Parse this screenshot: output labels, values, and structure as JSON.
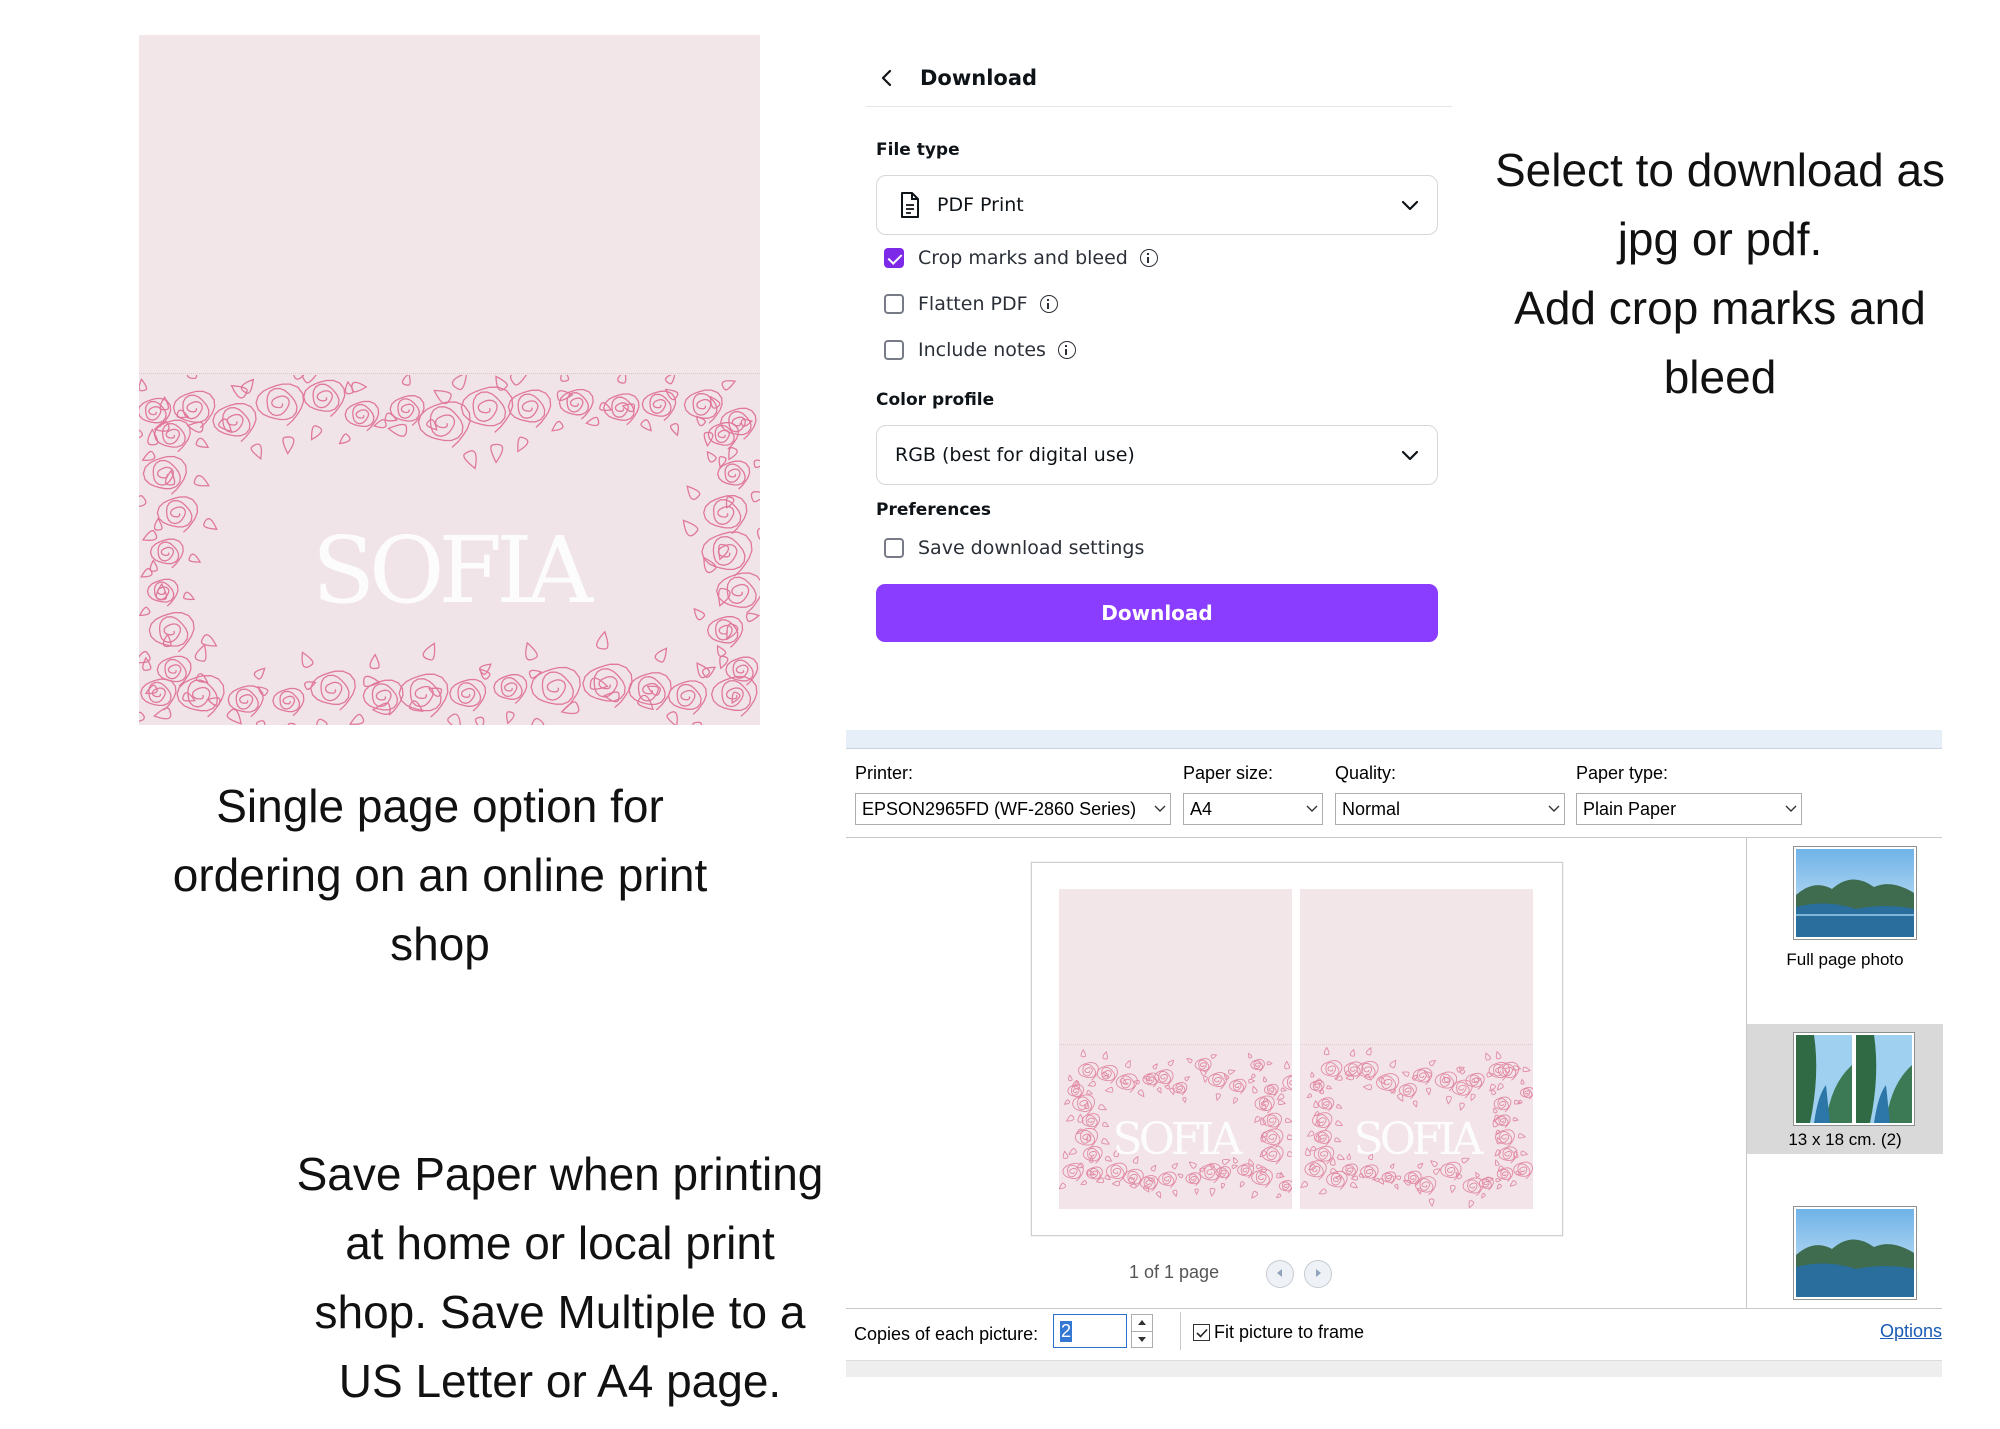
{
  "card": {
    "name": "SOFIA",
    "colors": {
      "background": "#f1e4e8",
      "rose_line": "#e0789a",
      "name_text": "#ffffff"
    }
  },
  "captions": {
    "single_page": [
      "Single page option for",
      "ordering on an online print",
      "shop"
    ],
    "select_download": [
      "Select to download as",
      "jpg or pdf.",
      "Add crop marks and",
      "bleed"
    ],
    "save_paper": [
      "Save Paper when printing",
      "at home or local print",
      "shop. Save Multiple to a",
      "US Letter or A4 page."
    ]
  },
  "download_panel": {
    "back_icon": "chevron-left-icon",
    "title": "Download",
    "file_type_label": "File type",
    "file_type_icon": "document-icon",
    "file_type_value": "PDF Print",
    "options": [
      {
        "label": "Crop marks and bleed",
        "checked": true,
        "info": true
      },
      {
        "label": "Flatten PDF",
        "checked": false,
        "info": true
      },
      {
        "label": "Include notes",
        "checked": false,
        "info": true
      }
    ],
    "color_profile_label": "Color profile",
    "color_profile_value": "RGB (best for digital use)",
    "preferences_label": "Preferences",
    "save_settings_label": "Save download settings",
    "save_settings_checked": false,
    "download_button": "Download",
    "accent_color": "#8b3dff"
  },
  "print_dialog": {
    "printer_label": "Printer:",
    "printer_value": "EPSON2965FD (WF-2860 Series)",
    "paper_size_label": "Paper size:",
    "paper_size_value": "A4",
    "quality_label": "Quality:",
    "quality_value": "Normal",
    "paper_type_label": "Paper type:",
    "paper_type_value": "Plain Paper",
    "preview_name": "SOFIA",
    "page_indicator": "1 of 1 page",
    "layouts": [
      {
        "label": "Full page photo",
        "selected": false
      },
      {
        "label": "13 x 18 cm. (2)",
        "selected": true
      },
      {
        "label": "",
        "selected": false
      }
    ],
    "copies_label": "Copies of each picture:",
    "copies_value": "2",
    "fit_label": "Fit picture to frame",
    "fit_checked": true,
    "options_link": "Options"
  }
}
